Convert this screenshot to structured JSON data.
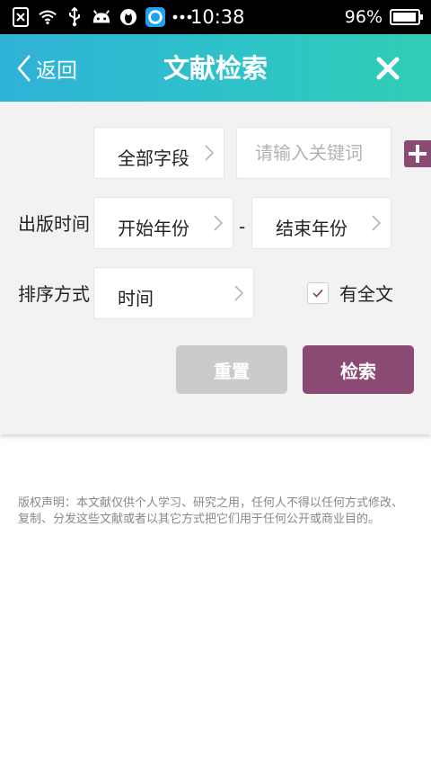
{
  "status_bar": {
    "time": "10:38",
    "battery": "96%",
    "battery_level": 0.96,
    "icons": [
      "sim-error-icon",
      "wifi-icon",
      "usb-icon",
      "android-icon",
      "qq-penguin-icon",
      "app-badge-icon",
      "more-dots-icon"
    ]
  },
  "header": {
    "back_label": "返回",
    "title": "文献检索",
    "close_icon": "close-icon"
  },
  "form": {
    "field_select": "全部字段",
    "keyword_placeholder": "请输入关键词",
    "keyword_value": "",
    "publish_time_label": "出版时间",
    "start_year": "开始年份",
    "range_separator": "-",
    "end_year": "结束年份",
    "sort_label": "排序方式",
    "sort_value": "时间",
    "fulltext_label": "有全文",
    "fulltext_checked": true,
    "reset_label": "重置",
    "search_label": "检索"
  },
  "notice": "版权声明：本文献仅供个人学习、研究之用，任何人不得以任何方式修改、复制、分发这些文献或者以其它方式把它们用于任何公开或商业目的。",
  "colors": {
    "header_gradient_start": "#2fb2d8",
    "header_gradient_end": "#31cdb5",
    "accent": "#8a4a73",
    "reset_button": "#cbcbcb",
    "panel_bg": "#f2f2f2"
  }
}
